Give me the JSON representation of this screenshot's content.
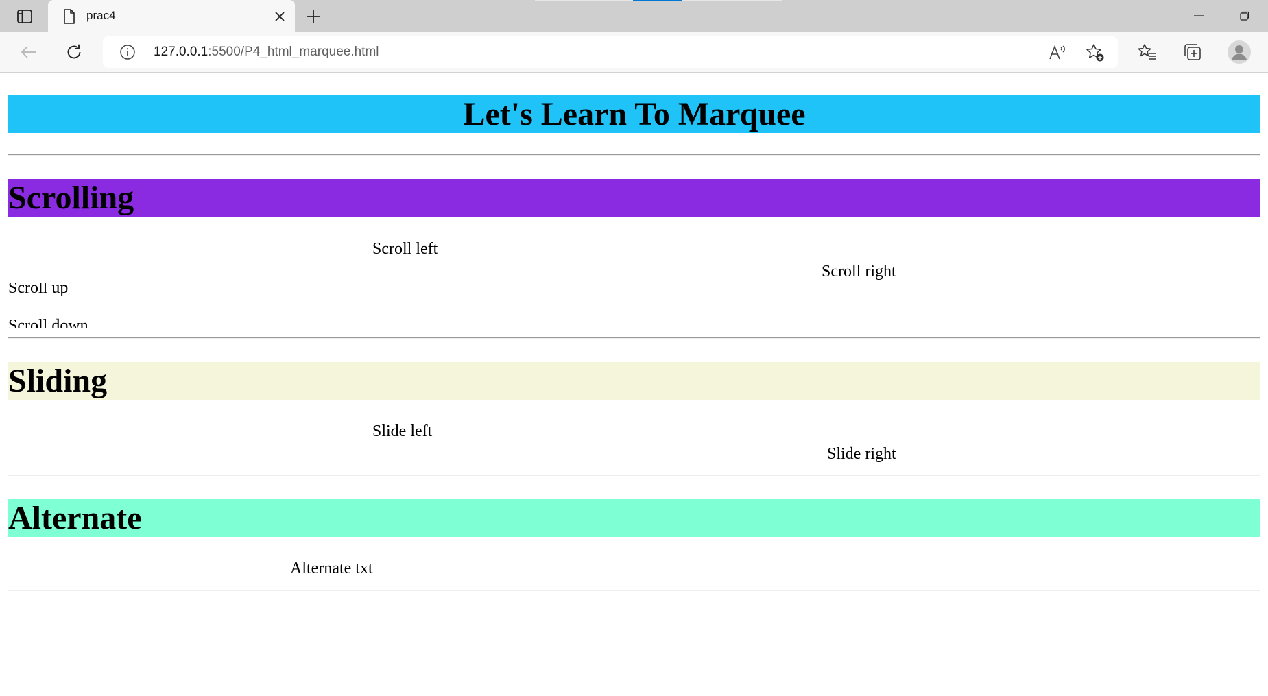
{
  "browser": {
    "tab_title": "prac4",
    "url_host": "127.0.0.1",
    "url_rest": ":5500/P4_html_marquee.html",
    "icons": {
      "tab_actions": "tab-actions-icon",
      "page": "document-icon",
      "close": "close-icon",
      "new_tab": "plus-icon",
      "minimize": "minimize-icon",
      "restore": "restore-icon",
      "back": "back-arrow-icon",
      "refresh": "refresh-icon",
      "info": "info-icon",
      "read_aloud": "read-aloud-icon",
      "add_favorite": "star-add-icon",
      "favorites": "favorites-icon",
      "collections": "collections-icon",
      "profile": "profile-icon"
    },
    "accent_color": "#0078d4"
  },
  "page": {
    "title": "Let's Learn To Marquee",
    "title_bg": "#20c3f8",
    "sections": {
      "scrolling": {
        "heading": "Scrolling",
        "bg": "#8a2be2",
        "scroll_left": "Scroll left",
        "scroll_right": "Scroll right",
        "scroll_up": "Scroll up",
        "scroll_down": "Scroll down"
      },
      "sliding": {
        "heading": "Sliding",
        "bg": "#f5f5dc",
        "slide_left": "Slide left",
        "slide_right": "Slide right"
      },
      "alternate": {
        "heading": "Alternate",
        "bg": "#7fffd4",
        "alternate_text": "Alternate txt"
      }
    }
  }
}
